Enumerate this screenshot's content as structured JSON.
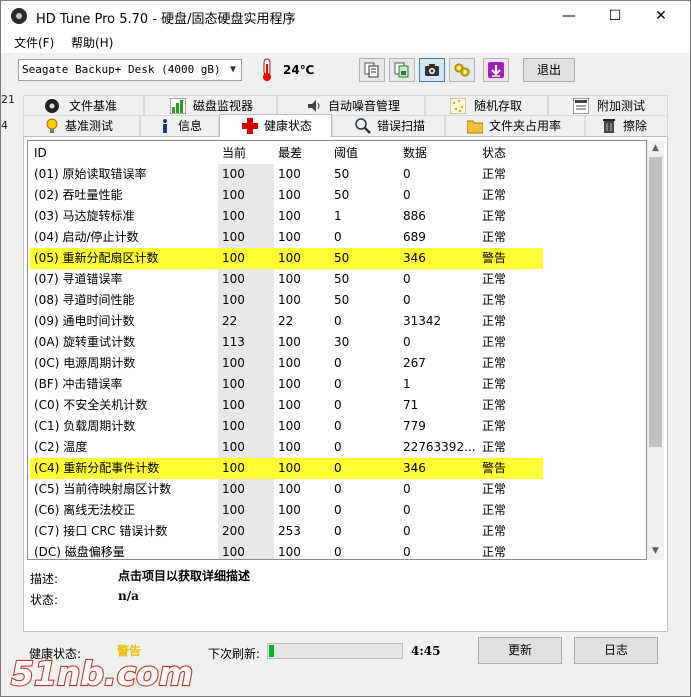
{
  "window": {
    "title": "HD Tune Pro 5.70 - 硬盘/固态硬盘实用程序",
    "minimize": "—",
    "maximize": "☐",
    "close": "✕"
  },
  "menu": [
    {
      "label": "文件(F)"
    },
    {
      "label": "帮助(H)"
    }
  ],
  "toolbar": {
    "drive": "Seagate Backup+  Desk (4000 gB)",
    "temperature": "24℃",
    "exit_label": "退出",
    "buttons": [
      "copy-text-icon",
      "copy-screenshot-icon",
      "camera-icon",
      "settings-icon",
      "save-icon"
    ]
  },
  "tabs_top": [
    {
      "label": "文件基准",
      "icon": "file-benchmark-icon"
    },
    {
      "label": "磁盘监视器",
      "icon": "disk-monitor-icon"
    },
    {
      "label": "自动噪音管理",
      "icon": "speaker-icon"
    },
    {
      "label": "随机存取",
      "icon": "random-access-icon"
    },
    {
      "label": "附加测试",
      "icon": "extra-tests-icon"
    }
  ],
  "tabs_bottom": [
    {
      "label": "基准测试",
      "icon": "benchmark-icon"
    },
    {
      "label": "信息",
      "icon": "info-icon"
    },
    {
      "label": "健康状态",
      "icon": "health-icon",
      "selected": true
    },
    {
      "label": "错误扫描",
      "icon": "error-scan-icon"
    },
    {
      "label": "文件夹占用率",
      "icon": "folder-usage-icon"
    },
    {
      "label": "擦除",
      "icon": "erase-icon"
    }
  ],
  "table": {
    "headers": [
      "ID",
      "当前",
      "最差",
      "阈值",
      "数据",
      "状态"
    ],
    "rows": [
      [
        "(01) 原始读取错误率",
        "100",
        "100",
        "50",
        "0",
        "正常"
      ],
      [
        "(02) 吞吐量性能",
        "100",
        "100",
        "50",
        "0",
        "正常"
      ],
      [
        "(03) 马达旋转标准",
        "100",
        "100",
        "1",
        "886",
        "正常"
      ],
      [
        "(04) 启动/停止计数",
        "100",
        "100",
        "0",
        "689",
        "正常"
      ],
      [
        "(05) 重新分配扇区计数",
        "100",
        "100",
        "50",
        "346",
        "警告"
      ],
      [
        "(07) 寻道错误率",
        "100",
        "100",
        "50",
        "0",
        "正常"
      ],
      [
        "(08) 寻道时间性能",
        "100",
        "100",
        "50",
        "0",
        "正常"
      ],
      [
        "(09) 通电时间计数",
        "22",
        "22",
        "0",
        "31342",
        "正常"
      ],
      [
        "(0A) 旋转重试计数",
        "113",
        "100",
        "30",
        "0",
        "正常"
      ],
      [
        "(0C) 电源周期计数",
        "100",
        "100",
        "0",
        "267",
        "正常"
      ],
      [
        "(BF) 冲击错误率",
        "100",
        "100",
        "0",
        "1",
        "正常"
      ],
      [
        "(C0) 不安全关机计数",
        "100",
        "100",
        "0",
        "71",
        "正常"
      ],
      [
        "(C1) 负载周期计数",
        "100",
        "100",
        "0",
        "779",
        "正常"
      ],
      [
        "(C2) 温度",
        "100",
        "100",
        "0",
        "22763392...",
        "正常"
      ],
      [
        "(C4) 重新分配事件计数",
        "100",
        "100",
        "0",
        "346",
        "警告"
      ],
      [
        "(C5) 当前待映射扇区计数",
        "100",
        "100",
        "0",
        "0",
        "正常"
      ],
      [
        "(C6) 离线无法校正",
        "100",
        "100",
        "0",
        "0",
        "正常"
      ],
      [
        "(C7) 接口 CRC 错误计数",
        "200",
        "253",
        "0",
        "0",
        "正常"
      ],
      [
        "(DC) 磁盘偏移量",
        "100",
        "100",
        "0",
        "0",
        "正常"
      ]
    ],
    "warning_status": "警告",
    "highlight_color": "#ffff33"
  },
  "detail": {
    "desc_label": "描述:",
    "desc_value": "点击项目以获取详细描述",
    "status_label": "状态:",
    "status_value": "n/a"
  },
  "footer": {
    "health_label": "健康状态:",
    "health_value": "警告",
    "health_color": "#e8c000",
    "refresh_label": "下次刷新:",
    "refresh_progress": 0.04,
    "countdown": "4:45",
    "update_button": "更新",
    "log_button": "日志"
  },
  "watermark": "51nb.com",
  "background_fragments": [
    "21",
    "4"
  ]
}
